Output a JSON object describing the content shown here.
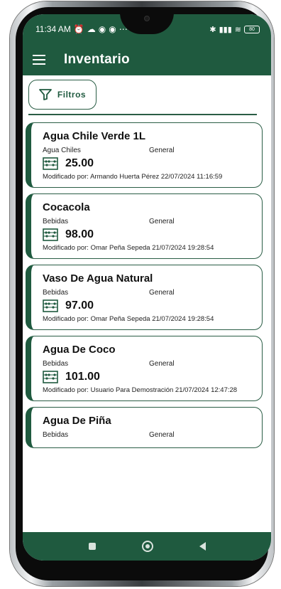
{
  "status_bar": {
    "time": "11:34 AM",
    "left_icons": [
      "alarm-icon",
      "cloud-icon",
      "eye-icon",
      "eye-icon",
      "more-dots"
    ],
    "right_icons": [
      "bluetooth-icon",
      "signal-icon",
      "wifi-icon"
    ],
    "battery": "80"
  },
  "app_bar": {
    "title": "Inventario",
    "menu_icon": "hamburger-menu-icon"
  },
  "filters_button": {
    "label": "Filtros",
    "icon": "filter-funnel-icon"
  },
  "items": [
    {
      "name": "Agua Chile Verde 1L",
      "category": "Agua Chiles",
      "group": "General",
      "quantity": "25.00",
      "modified": "Modificado por: Armando Huerta Pérez  22/07/2024 11:16:59"
    },
    {
      "name": "Cocacola",
      "category": "Bebidas",
      "group": "General",
      "quantity": "98.00",
      "modified": "Modificado por: Omar Peña Sepeda  21/07/2024 19:28:54"
    },
    {
      "name": "Vaso De Agua Natural",
      "category": "Bebidas",
      "group": "General",
      "quantity": "97.00",
      "modified": "Modificado por: Omar Peña Sepeda  21/07/2024 19:28:54"
    },
    {
      "name": "Agua De Coco",
      "category": "Bebidas",
      "group": "General",
      "quantity": "101.00",
      "modified": "Modificado por: Usuario Para Demostración  21/07/2024 12:47:28"
    },
    {
      "name": "Agua De Piña",
      "category": "Bebidas",
      "group": "General"
    }
  ],
  "nav_bar": [
    "recents-square",
    "home-circle",
    "back-triangle"
  ],
  "colors": {
    "primary": "#1f5a3f",
    "card_border": "#2a5d45"
  }
}
